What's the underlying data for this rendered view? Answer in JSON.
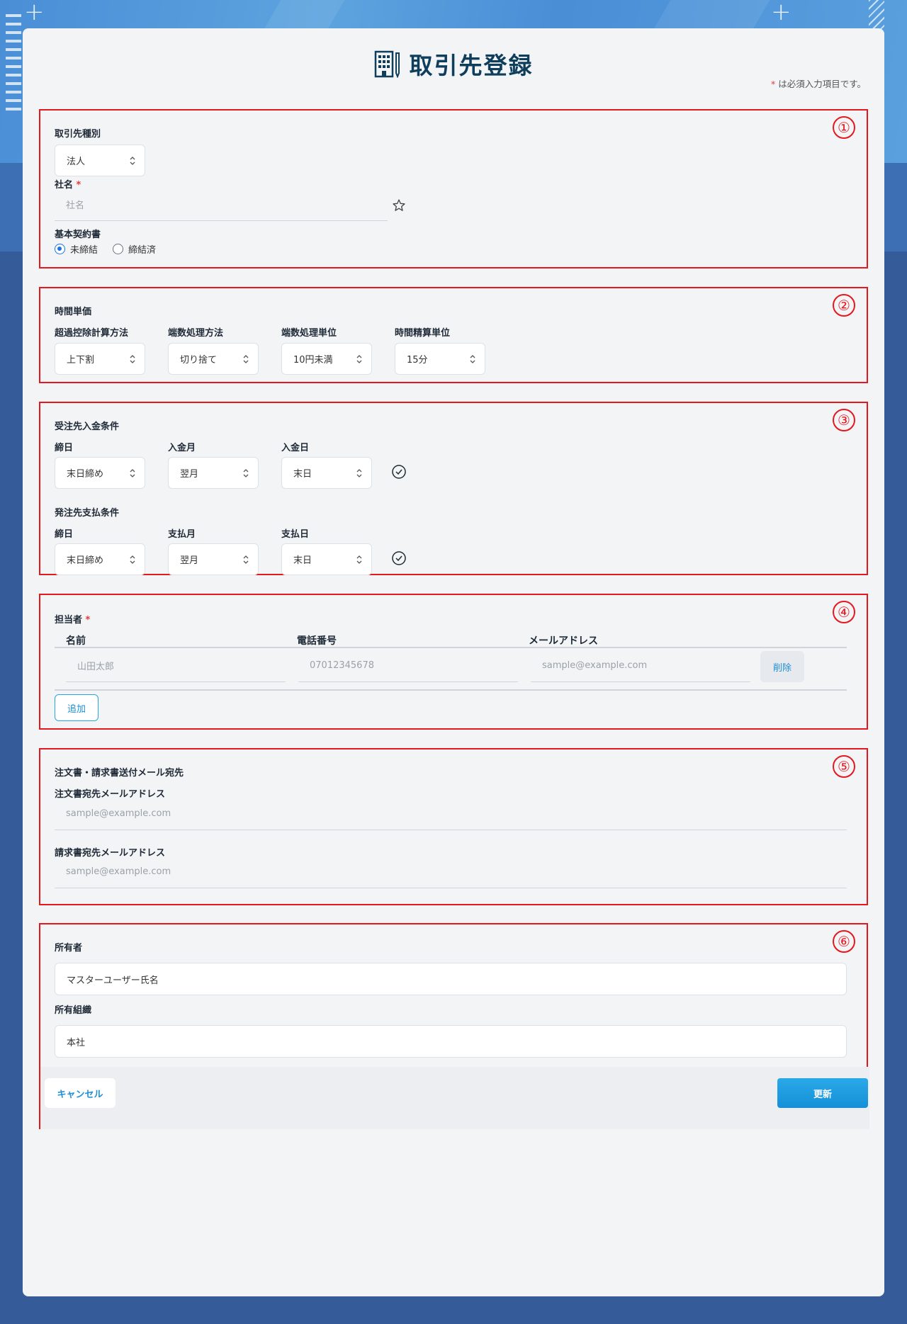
{
  "header": {
    "title": "取引先登録",
    "required_note": "は必須入力項目です。",
    "required_mark": "*"
  },
  "section_badges": [
    "①",
    "②",
    "③",
    "④",
    "⑤",
    "⑥"
  ],
  "section1": {
    "type_label": "取引先種別",
    "type_value": "法人",
    "company_label": "社名",
    "company_placeholder": "社名",
    "contract_label": "基本契約書",
    "contract_options": [
      "未締結",
      "締結済"
    ],
    "contract_selected": "未締結"
  },
  "section2": {
    "title": "時間単価",
    "fields": [
      {
        "label": "超過控除計算方法",
        "value": "上下割"
      },
      {
        "label": "端数処理方法",
        "value": "切り捨て"
      },
      {
        "label": "端数処理単位",
        "value": "10円未満"
      },
      {
        "label": "時間精算単位",
        "value": "15分"
      }
    ]
  },
  "section3": {
    "receive_title": "受注先入金条件",
    "receive_fields": [
      {
        "label": "締日",
        "value": "末日締め"
      },
      {
        "label": "入金月",
        "value": "翌月"
      },
      {
        "label": "入金日",
        "value": "末日"
      }
    ],
    "pay_title": "発注先支払条件",
    "pay_fields": [
      {
        "label": "締日",
        "value": "末日締め"
      },
      {
        "label": "支払月",
        "value": "翌月"
      },
      {
        "label": "支払日",
        "value": "末日"
      }
    ]
  },
  "section4": {
    "title": "担当者",
    "columns": [
      "名前",
      "電話番号",
      "メールアドレス"
    ],
    "row": {
      "name_placeholder": "山田太郎",
      "phone_placeholder": "07012345678",
      "email_placeholder": "sample@example.com"
    },
    "delete_label": "削除",
    "add_label": "追加"
  },
  "section5": {
    "title": "注文書・請求書送付メール宛先",
    "order_label": "注文書宛先メールアドレス",
    "order_placeholder": "sample@example.com",
    "invoice_label": "請求書宛先メールアドレス",
    "invoice_placeholder": "sample@example.com"
  },
  "section6": {
    "owner_label": "所有者",
    "owner_value": "マスターユーザー氏名",
    "org_label": "所有組織",
    "org_value": "本社"
  },
  "footer": {
    "cancel_label": "キャンセル",
    "update_label": "更新"
  }
}
